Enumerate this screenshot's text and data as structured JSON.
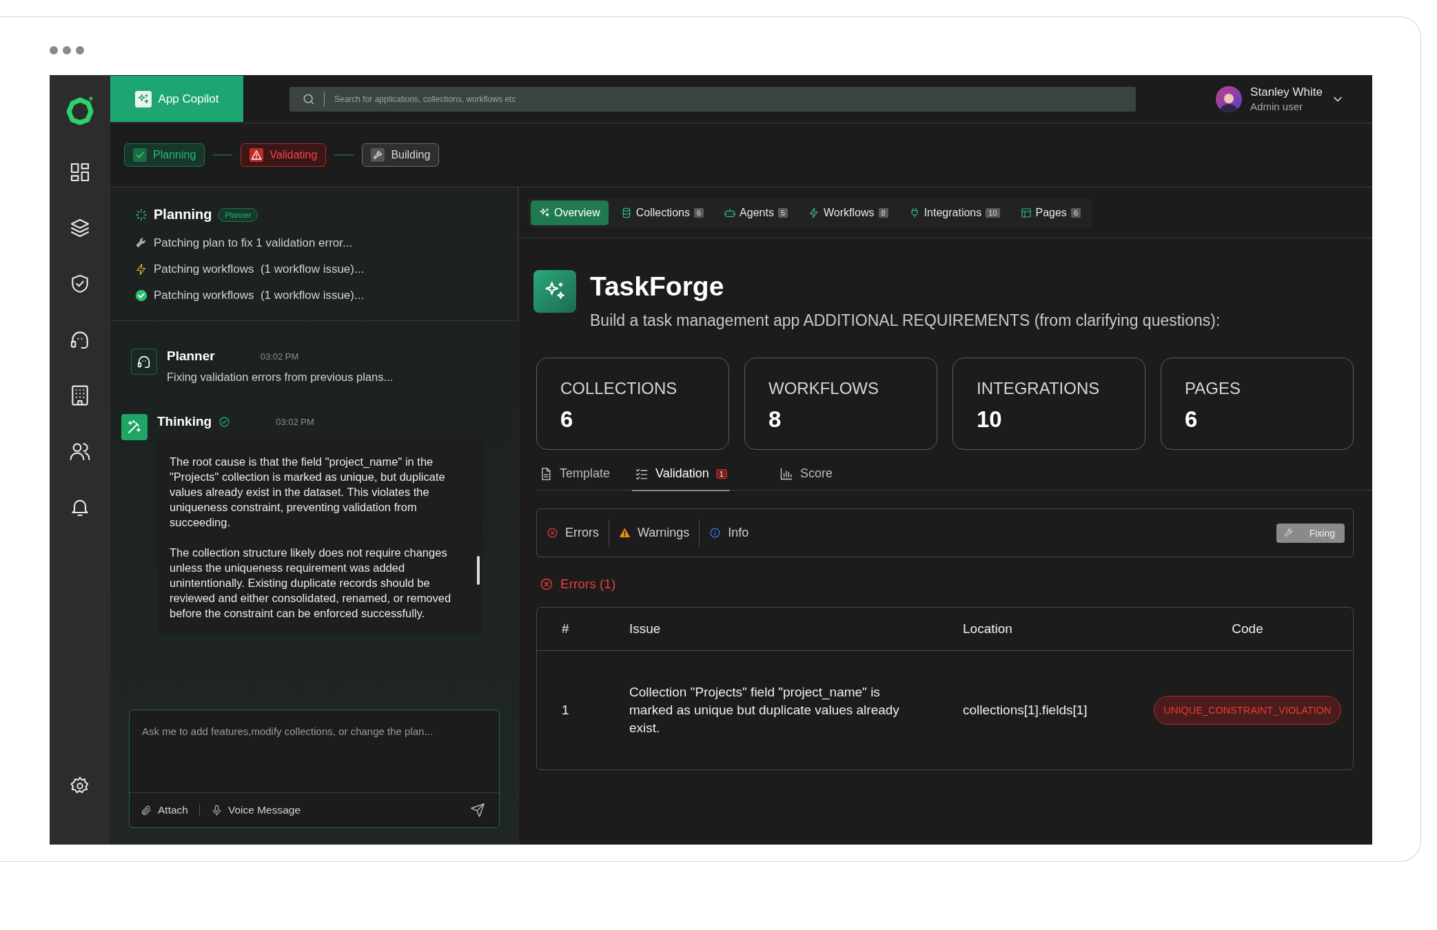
{
  "app": {
    "name": "App Copilot"
  },
  "search": {
    "placeholder": "Search for applications, collections, workflows etc"
  },
  "user": {
    "name": "Stanley White",
    "role": "Admin user"
  },
  "steps": [
    {
      "label": "Planning",
      "kind": "done"
    },
    {
      "label": "Validating",
      "kind": "error"
    },
    {
      "label": "Building",
      "kind": "pending"
    }
  ],
  "planning": {
    "title": "Planning",
    "badge": "Planner",
    "items": [
      {
        "text": "Patching plan to fix 1 validation error...",
        "kind": "wrench"
      },
      {
        "text": "Patching workflows  (1 workflow issue)...",
        "kind": "bolt"
      },
      {
        "text": "Patching workflows  (1 workflow issue)...",
        "kind": "done"
      }
    ]
  },
  "messages": [
    {
      "kind": "planner",
      "author": "Planner",
      "time": "03:02 PM",
      "paragraphs": [
        "Fixing validation errors from previous plans..."
      ]
    },
    {
      "kind": "thinking",
      "author": "Thinking",
      "time": "03:02 PM",
      "verified": true,
      "paragraphs": [
        "The root cause is that the field \"project_name\" in the \"Projects\" collection is marked as unique, but duplicate values already exist in the dataset. This violates the uniqueness constraint, preventing validation from succeeding.",
        "The collection structure likely does not require changes unless the uniqueness requirement was added unintentionally. Existing duplicate records should be reviewed and either consolidated, renamed, or removed before the constraint can be enforced successfully."
      ]
    }
  ],
  "composer": {
    "placeholder": "Ask me to add features,modify collections, or change the plan...",
    "attach": "Attach",
    "voice": "Voice Message"
  },
  "tabs": [
    {
      "label": "Overview",
      "kind": "sparkle",
      "selected": true
    },
    {
      "label": "Collections",
      "kind": "database",
      "count": "6",
      "selected": false
    },
    {
      "label": "Agents",
      "kind": "robot",
      "count": "5",
      "selected": false
    },
    {
      "label": "Workflows",
      "kind": "bolt",
      "count": "8",
      "selected": false
    },
    {
      "label": "Integrations",
      "kind": "plug",
      "count": "10",
      "selected": false
    },
    {
      "label": "Pages",
      "kind": "layout",
      "count": "6",
      "selected": false
    }
  ],
  "project": {
    "name": "TaskForge",
    "description": "Build a task management app ADDITIONAL REQUIREMENTS (from clarifying questions):"
  },
  "stats": [
    {
      "label": "COLLECTIONS",
      "value": "6"
    },
    {
      "label": "WORKFLOWS",
      "value": "8"
    },
    {
      "label": "INTEGRATIONS",
      "value": "10"
    },
    {
      "label": "PAGES",
      "value": "6"
    }
  ],
  "subtabs": [
    {
      "label": "Template",
      "kind": "document",
      "selected": false
    },
    {
      "label": "Validation",
      "kind": "checklist",
      "badge": "1",
      "selected": true
    },
    {
      "label": "Score",
      "kind": "chart",
      "selected": false
    }
  ],
  "filters": [
    {
      "label": "Errors",
      "kind": "error"
    },
    {
      "label": "Warnings",
      "kind": "warning"
    },
    {
      "label": "Info",
      "kind": "info"
    }
  ],
  "fix_button": "Fixing",
  "errors_heading": "Errors (1)",
  "table": {
    "columns": [
      "#",
      "Issue",
      "Location",
      "Code"
    ],
    "rows": [
      {
        "number": "1",
        "issue": "Collection \"Projects\" field \"project_name\" is marked as unique but duplicate values already exist.",
        "location": "collections[1].fields[1]",
        "code": "UNIQUE_CONSTRAINT_VIOLATION"
      }
    ]
  }
}
